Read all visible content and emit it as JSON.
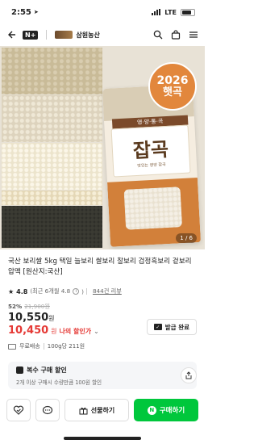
{
  "status_bar": {
    "time": "2:55",
    "network": "LTE",
    "battery_level": 0.75
  },
  "nav": {
    "nplus": "N+",
    "store_name": "삼원농산"
  },
  "hero": {
    "badge_year": "2026",
    "badge_text": "햇곡",
    "bag_tag": "영·양·통·곡",
    "bag_title": "잡곡",
    "bag_subtitle": "맛있는 영양 잡곡",
    "counter": "1 / 6"
  },
  "product": {
    "title": "국산 보리쌀 5kg 택일 늘보리 쌀보리 찰보리 검정흑보리 겉보리 압맥 [원산지:국산]",
    "rating": "4.8",
    "rating_detail": "(최근 6개월 4.8",
    "review_count": "844건 리뷰",
    "discount_pct": "52%",
    "original_price": "21,900원",
    "price": "10,550",
    "price_unit": "원",
    "my_price": "10,450",
    "my_price_unit": "원",
    "my_price_label": "나의 할인가",
    "coupon_label": "발급 완료",
    "shipping": "무료배송",
    "unit_price": "100g당 211원"
  },
  "multi_discount": {
    "title": "복수 구매 할인",
    "desc": "2개 이상 구매시 수량만큼 100원 할인"
  },
  "bottom": {
    "gift_label": "선물하기",
    "buy_label": "구매하기"
  }
}
